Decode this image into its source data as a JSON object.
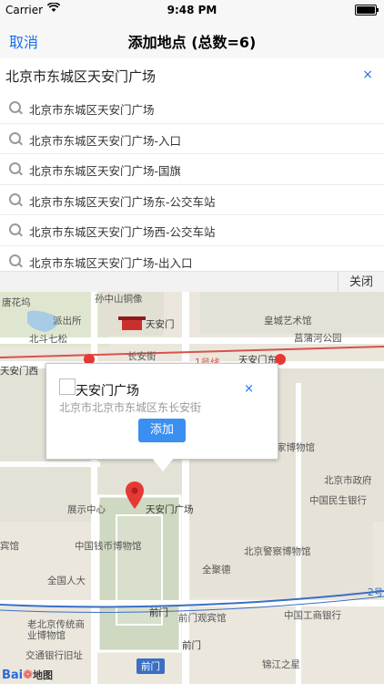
{
  "status_bar": {
    "carrier": "Carrier",
    "time": "9:48 PM",
    "battery_level": 0.9
  },
  "navbar": {
    "cancel_label": "取消",
    "title": "添加地点 (总数=6)"
  },
  "search": {
    "value": "北京市东城区天安门广场"
  },
  "suggestions": [
    "北京市东城区天安门广场",
    "北京市东城区天安门广场-入口",
    "北京市东城区天安门广场-国旗",
    "北京市东城区天安门广场东-公交车站",
    "北京市东城区天安门广场西-公交车站",
    "北京市东城区天安门广场-出入口"
  ],
  "close_label": "关闭",
  "map": {
    "labels": {
      "tanggeng": "唐花坞",
      "sunzhongshan": "孙中山铜像",
      "paichusuo": "派出所",
      "tiananmen": "天安门",
      "huanghuang": "皇城艺术馆",
      "beidouqi": "北斗七松",
      "changanjie": "长安街",
      "changpuhe": "菖蒲河公园",
      "line1": "1号线",
      "tiananmenxi": "天安门西",
      "tiananmendong": "天安门东",
      "jia_bowuguan": "家博物馆",
      "beijingshizhengfu": "北京市政府",
      "minsheng": "中国民生银行",
      "zhanshi": "展示中心",
      "tiananmenguangchang": "天安门广场",
      "binguan": "宾馆",
      "qianbi": "中国钱币博物馆",
      "jingcha": "北京警察博物馆",
      "quanjude": "全聚德",
      "renda": "全国人大",
      "qianmen_metro": "前门",
      "qianmen_binguan": "前门观宾馆",
      "gongshang": "中国工商银行",
      "laobeijing": "老北京传统商业博物馆",
      "jiaotong": "交通银行旧址",
      "qianmen": "前门",
      "qianmen_box": "前门",
      "jinjiang": "锦江之星",
      "line2": "2号",
      "baidu_logo": "Bai",
      "baidu_map": "地图"
    }
  },
  "popup": {
    "title": "天安门广场",
    "address": "北京市北京市东城区东长安街",
    "add_label": "添加",
    "close_icon": "×"
  },
  "colors": {
    "accent": "#1a6ff0",
    "pin": "#e53935",
    "metro_line": "#d8524a"
  }
}
